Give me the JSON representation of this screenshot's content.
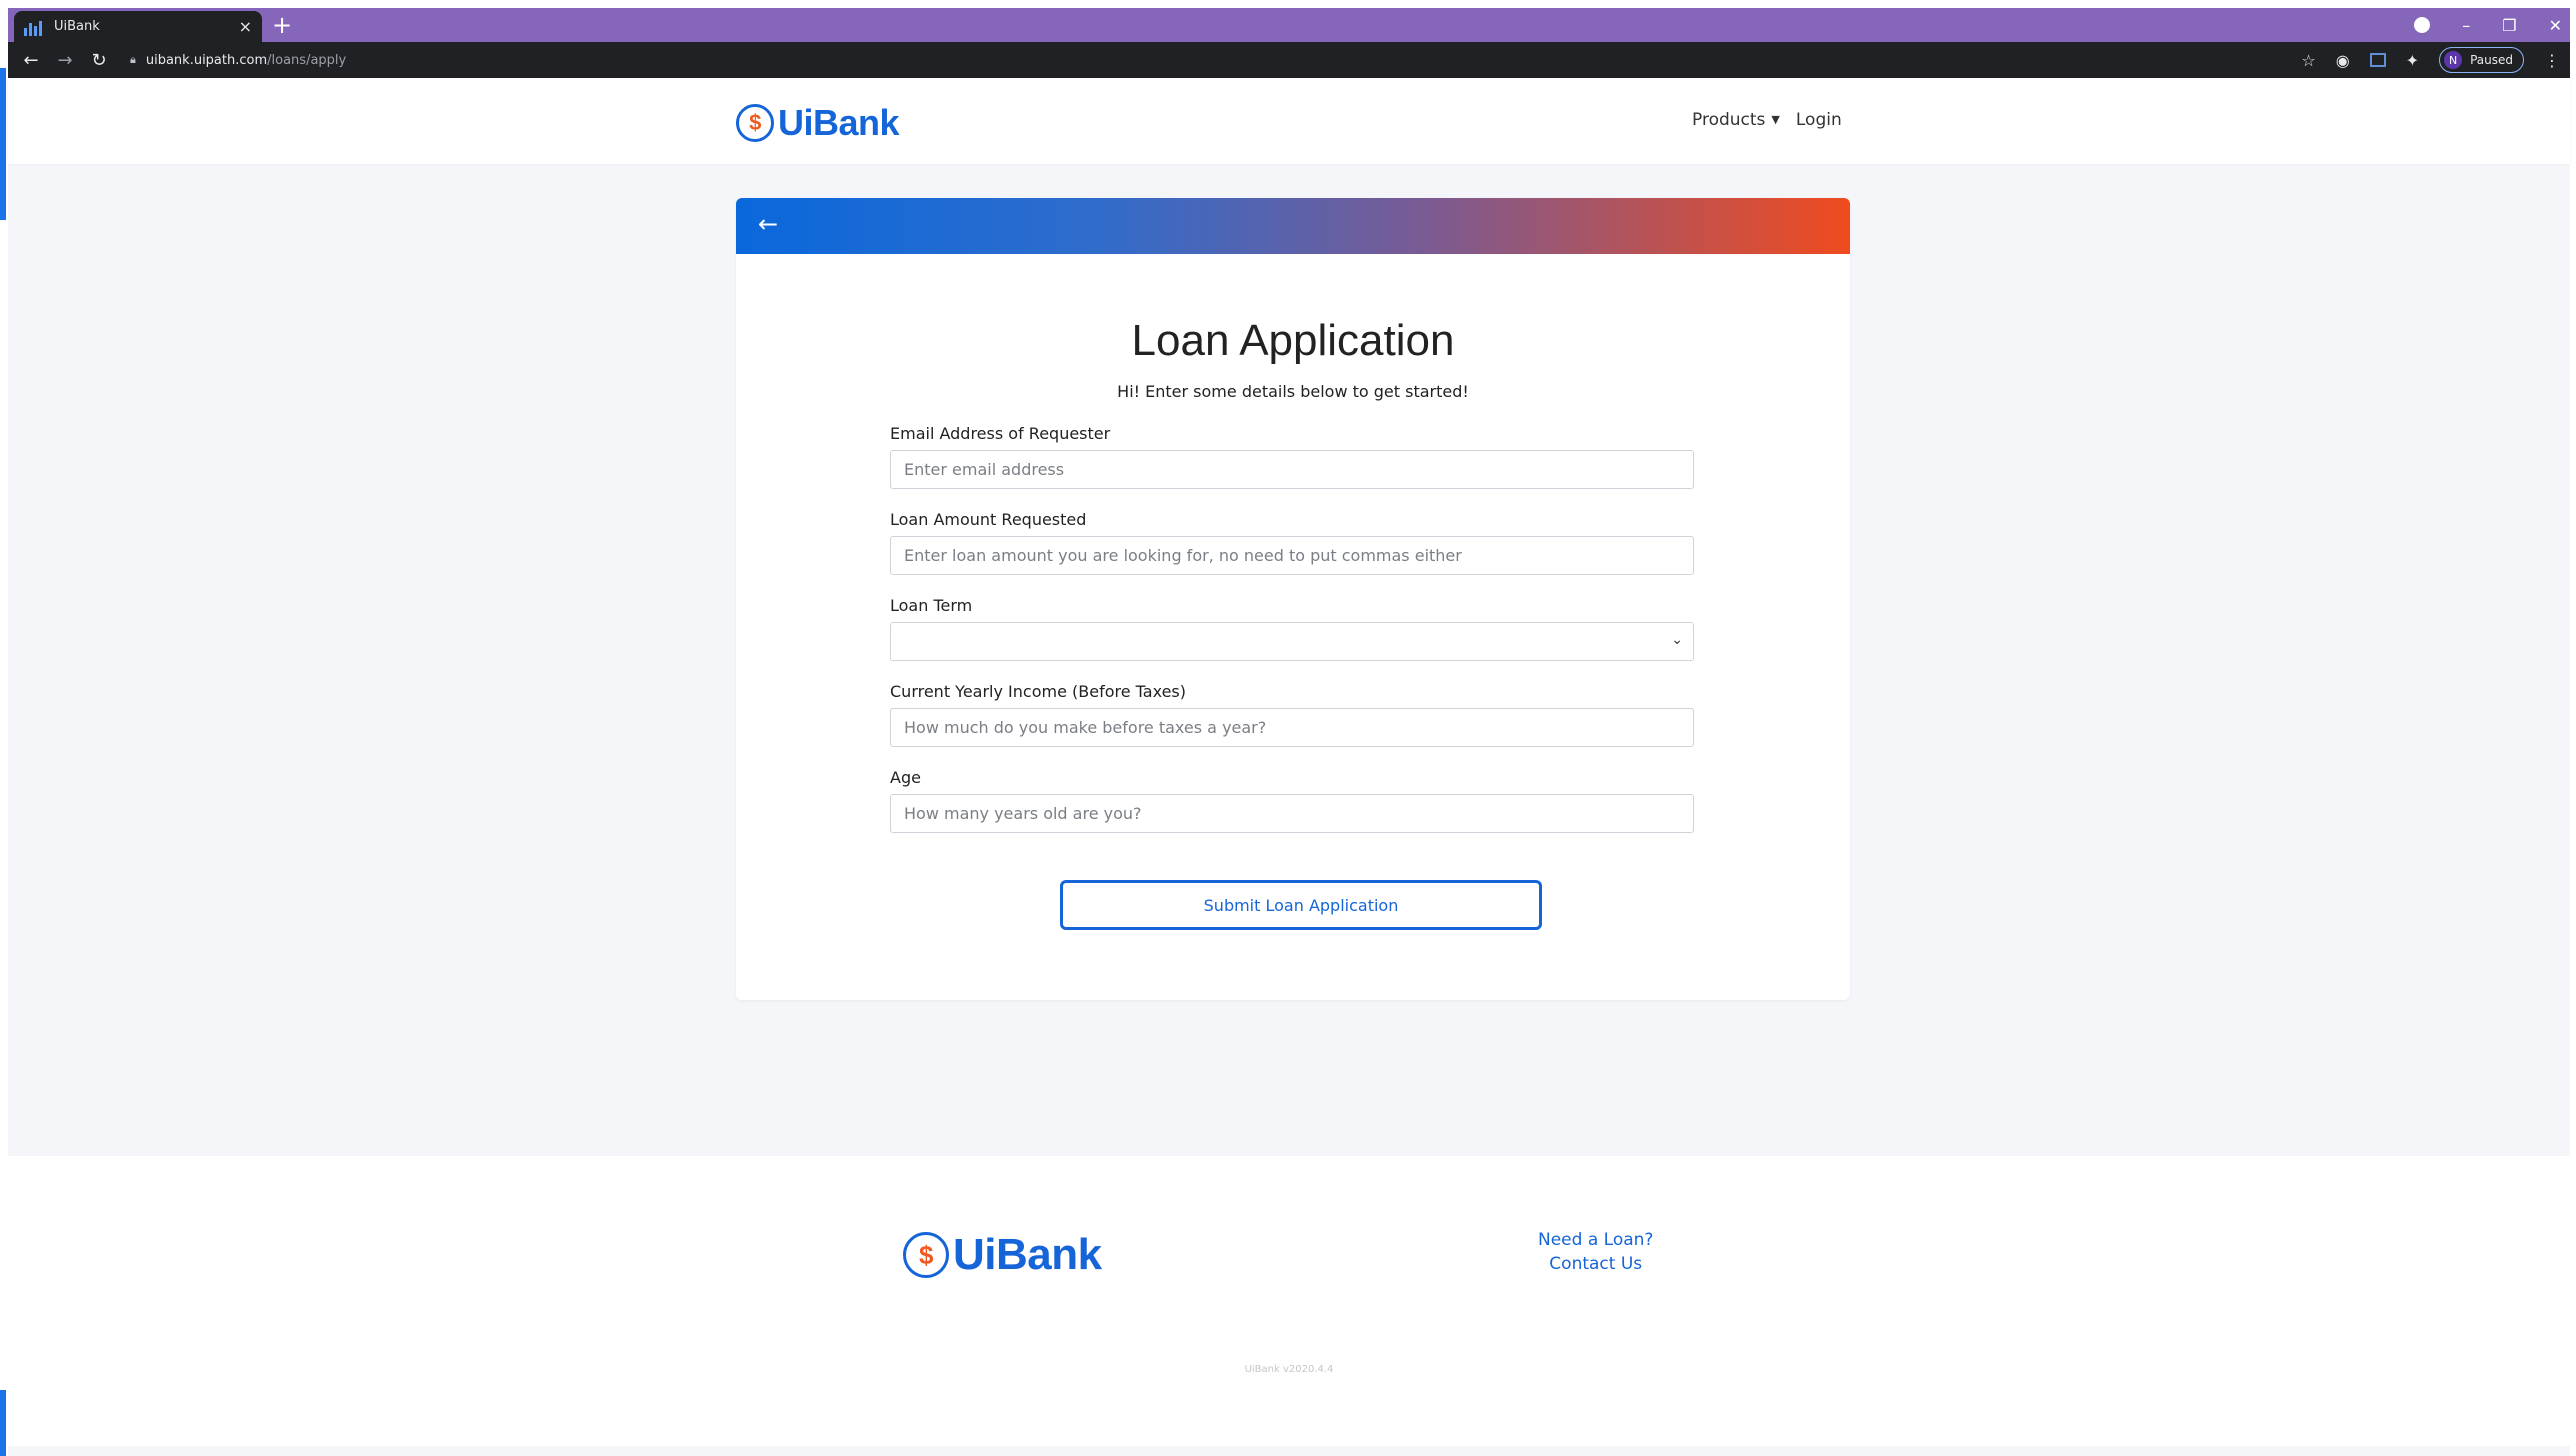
{
  "browser": {
    "tab_title": "UiBank",
    "tab_close": "×",
    "new_tab": "+",
    "url_host": "uibank.uipath.com",
    "url_path": "/loans/apply",
    "profile_initial": "N",
    "profile_status": "Paused"
  },
  "nav": {
    "logo_text": "UiBank",
    "logo_symbol": "$",
    "products_label": "Products",
    "login_label": "Login"
  },
  "form": {
    "title": "Loan Application",
    "subtitle": "Hi! Enter some details below to get started!",
    "email_label": "Email Address of Requester",
    "email_placeholder": "Enter email address",
    "amount_label": "Loan Amount Requested",
    "amount_placeholder": "Enter loan amount you are looking for, no need to put commas either",
    "term_label": "Loan Term",
    "term_value": "",
    "income_label": "Current Yearly Income (Before Taxes)",
    "income_placeholder": "How much do you make before taxes a year?",
    "age_label": "Age",
    "age_placeholder": "How many years old are you?",
    "submit_label": "Submit Loan Application"
  },
  "footer": {
    "logo_text": "UiBank",
    "logo_symbol": "$",
    "need_loan_label": "Need a Loan?",
    "contact_label": "Contact Us",
    "version": "UiBank v2020.4.4"
  },
  "colors": {
    "brand_blue": "#1565d8",
    "brand_orange": "#f04b1e",
    "tabstrip_purple": "#8566ba"
  },
  "icons": {
    "back": "arrow-left-icon",
    "reload": "reload-icon",
    "lock": "lock-icon",
    "star": "star-icon",
    "extensions": "puzzle-icon",
    "menu": "kebab-menu-icon"
  }
}
